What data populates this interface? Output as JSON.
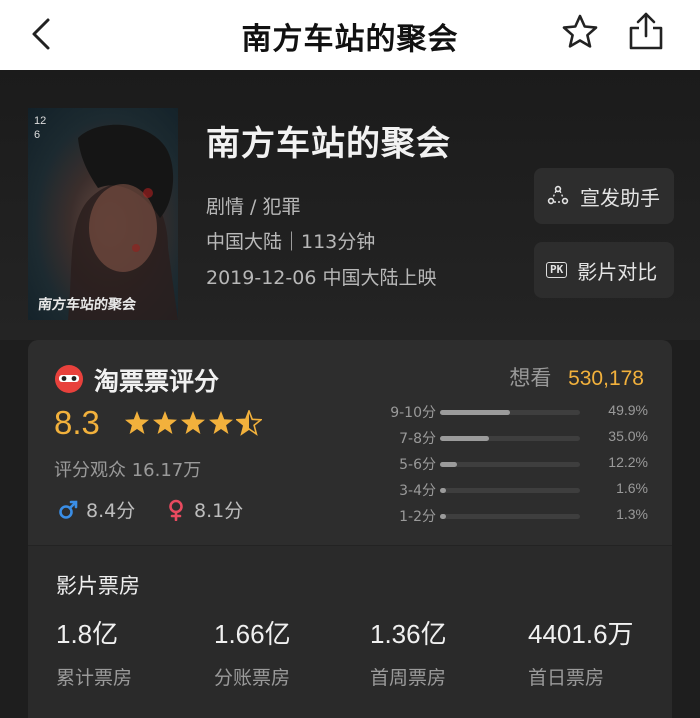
{
  "header": {
    "title": "南方车站的聚会"
  },
  "poster": {
    "date_line1": "12",
    "date_line2": "6",
    "title_text": "南方车站的聚会"
  },
  "movie": {
    "title": "南方车站的聚会",
    "genre": "剧情 / 犯罪",
    "region_duration": "中国大陆｜113分钟",
    "release": "2019-12-06 中国大陆上映"
  },
  "actions": {
    "promo": "宣发助手",
    "compare": "影片对比",
    "compare_icon": "PK"
  },
  "rating": {
    "title": "淘票票评分",
    "score": "8.3",
    "stars": 4.5,
    "count": "评分观众 16.17万",
    "male": "8.4分",
    "female": "8.1分",
    "want_label": "想看",
    "want_count": "530,178",
    "distribution": [
      {
        "label": "9-10分",
        "percent": "49.9%",
        "value": 49.9
      },
      {
        "label": "7-8分",
        "percent": "35.0%",
        "value": 35.0
      },
      {
        "label": "5-6分",
        "percent": "12.2%",
        "value": 12.2
      },
      {
        "label": "3-4分",
        "percent": "1.6%",
        "value": 1.6
      },
      {
        "label": "1-2分",
        "percent": "1.3%",
        "value": 1.3
      }
    ]
  },
  "box_office": {
    "title": "影片票房",
    "items": [
      {
        "value": "1.8亿",
        "label": "累计票房"
      },
      {
        "value": "1.66亿",
        "label": "分账票房"
      },
      {
        "value": "1.36亿",
        "label": "首周票房"
      },
      {
        "value": "4401.6万",
        "label": "首日票房"
      }
    ]
  },
  "colors": {
    "accent": "#f2b13c",
    "male": "#3a8ee6",
    "female": "#e84a5f",
    "brand": "#e8413c"
  },
  "icons": {
    "back": "chevron-left-icon",
    "favorite": "star-outline-icon",
    "share": "share-icon"
  }
}
